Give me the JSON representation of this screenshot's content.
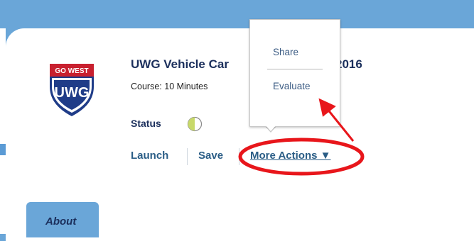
{
  "course": {
    "logo_text_top": "GO WEST",
    "logo_text_main": "UWG",
    "title_start": "UWG Vehicle Car",
    "title_end": "2016",
    "meta": "Course: 10 Minutes",
    "status_label": "Status",
    "status_icon": "half-circle-progress-icon"
  },
  "actions": {
    "launch_label": "Launch",
    "save_label": "Save",
    "more_label": "More Actions ▼"
  },
  "menu": {
    "items": [
      {
        "label": "Share"
      },
      {
        "label": "Evaluate"
      }
    ]
  },
  "tabs": {
    "about_label": "About"
  },
  "colors": {
    "header_blue": "#6aa6d8",
    "title_navy": "#1b2f5c",
    "link_blue": "#2a5d86",
    "annotation_red": "#e8161b",
    "logo_red": "#c8202f",
    "logo_blue": "#1f3c88",
    "status_fill": "#c8d96a"
  }
}
